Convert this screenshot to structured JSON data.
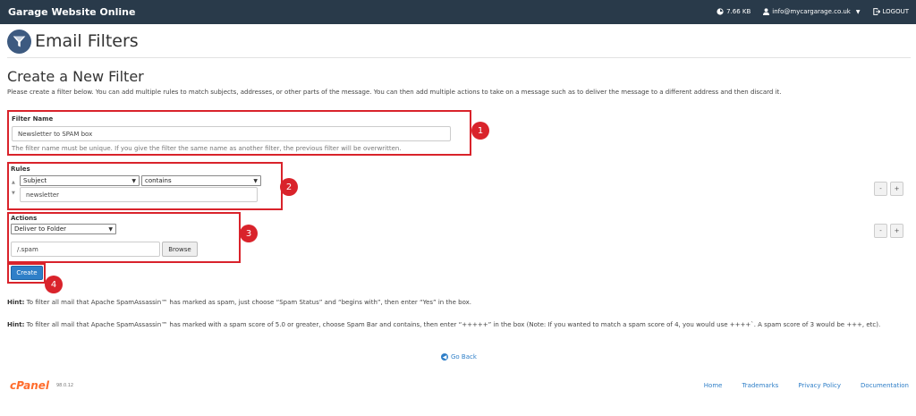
{
  "topbar": {
    "brand": "Garage Website Online",
    "disk_usage": "7.66 KB",
    "user_email": "info@mycargarage.co.uk",
    "logout": "LOGOUT"
  },
  "page": {
    "title": "Email Filters",
    "section_title": "Create a New Filter",
    "intro": "Please create a filter below. You can add multiple rules to match subjects, addresses, or other parts of the message. You can then add multiple actions to take on a message such as to deliver the message to a different address and then discard it."
  },
  "filter_name": {
    "label": "Filter Name",
    "value": "Newsletter to SPAM box",
    "help": "The filter name must be unique. If you give the filter the same name as another filter, the previous filter will be overwritten."
  },
  "rules": {
    "label": "Rules",
    "part_select": "Subject",
    "match_select": "contains",
    "value": "newsletter",
    "remove_btn": "-",
    "add_btn": "+"
  },
  "actions": {
    "label": "Actions",
    "action_select": "Deliver to Folder",
    "folder_value": "/.spam",
    "browse_btn": "Browse",
    "remove_btn": "-",
    "add_btn": "+"
  },
  "create_btn": "Create",
  "annotations": [
    "1",
    "2",
    "3",
    "4"
  ],
  "hints": {
    "hint1_label": "Hint:",
    "hint1_text": " To filter all mail that Apache SpamAssassin™ has marked as spam, just choose “Spam Status” and “begins with”, then enter “Yes” in the box.",
    "hint2_label": "Hint:",
    "hint2_text": " To filter all mail that Apache SpamAssassin™ has marked with a spam score of 5.0 or greater, choose Spam Bar and contains, then enter “+++++” in the box (Note: If you wanted to match a spam score of 4, you would use ++++`. A spam score of 3 would be +++, etc)."
  },
  "go_back": "Go Back",
  "footer": {
    "logo": "cPanel",
    "version": "98.0.12",
    "links": [
      "Home",
      "Trademarks",
      "Privacy Policy",
      "Documentation"
    ]
  },
  "colors": {
    "topbar": "#293a4a",
    "annotation_red": "#d9232b",
    "primary_blue": "#2f7fc8",
    "cpanel_orange": "#ff6c2c"
  },
  "icons": [
    "filter-funnel-icon",
    "gauge-icon",
    "user-icon",
    "logout-icon",
    "go-back-icon",
    "chevron-down-icon"
  ]
}
